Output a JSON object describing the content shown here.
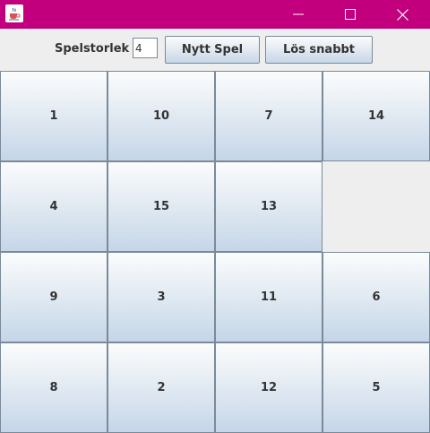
{
  "titlebar": {
    "background": "#c2007d",
    "icons": {
      "app": "java-cup-icon",
      "minimize": "minimize-icon",
      "maximize": "maximize-icon",
      "close": "close-icon"
    }
  },
  "toolbar": {
    "size_label": "Spelstorlek",
    "size_value": "4",
    "new_game_label": "Nytt Spel",
    "solve_label": "Lös snabbt"
  },
  "board": {
    "size": 4,
    "tiles": [
      [
        "1",
        "10",
        "7",
        "14"
      ],
      [
        "4",
        "15",
        "13",
        ""
      ],
      [
        "9",
        "3",
        "11",
        "6"
      ],
      [
        "8",
        "2",
        "12",
        "5"
      ]
    ]
  },
  "colors": {
    "tile_border": "#7a8a99",
    "tile_gradient_top": "#fbfcfd",
    "tile_gradient_bottom": "#c5d6e8",
    "window_background": "#eeeeee",
    "text": "#333333"
  }
}
